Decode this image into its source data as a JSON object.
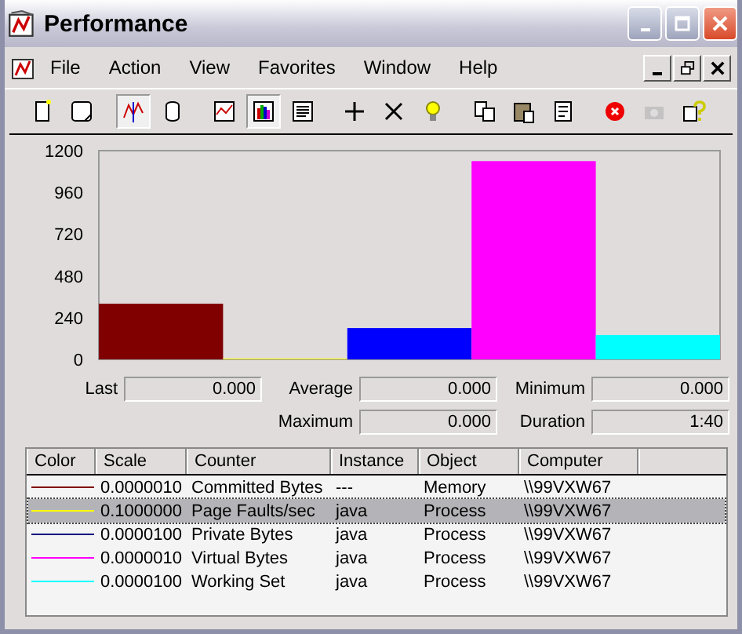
{
  "window": {
    "title": "Performance"
  },
  "menu": [
    {
      "label": "File"
    },
    {
      "label": "Action"
    },
    {
      "label": "View"
    },
    {
      "label": "Favorites"
    },
    {
      "label": "Window"
    },
    {
      "label": "Help"
    }
  ],
  "toolbar": [
    {
      "kind": "new",
      "selected": false,
      "disabled": false
    },
    {
      "kind": "clear",
      "selected": false,
      "disabled": false
    },
    {
      "kind": "current",
      "selected": true,
      "disabled": false
    },
    {
      "kind": "log",
      "selected": false,
      "disabled": false
    },
    {
      "kind": "graph",
      "selected": false,
      "disabled": false
    },
    {
      "kind": "histogram",
      "selected": true,
      "disabled": false
    },
    {
      "kind": "report",
      "selected": false,
      "disabled": false
    },
    {
      "kind": "add",
      "selected": false,
      "disabled": false
    },
    {
      "kind": "delete",
      "selected": false,
      "disabled": false
    },
    {
      "kind": "highlight",
      "selected": false,
      "disabled": false
    },
    {
      "kind": "copy",
      "selected": false,
      "disabled": false
    },
    {
      "kind": "paste",
      "selected": false,
      "disabled": false
    },
    {
      "kind": "properties",
      "selected": false,
      "disabled": false
    },
    {
      "kind": "freeze",
      "selected": false,
      "disabled": false
    },
    {
      "kind": "update",
      "selected": false,
      "disabled": true
    },
    {
      "kind": "help",
      "selected": false,
      "disabled": false
    }
  ],
  "chart": {
    "chart_data": {
      "type": "bar",
      "ylim": [
        0,
        1200
      ],
      "yticks": [
        0,
        240,
        480,
        720,
        960,
        1200
      ],
      "series": [
        {
          "color": "#800000",
          "values": [
            320
          ]
        },
        {
          "color": "#ffff00",
          "values": [
            0
          ]
        },
        {
          "color": "#0000ff",
          "values": [
            180
          ]
        },
        {
          "color": "#ff00ff",
          "values": [
            1140
          ]
        },
        {
          "color": "#00ffff",
          "values": [
            140
          ]
        }
      ]
    }
  },
  "stats": {
    "last": {
      "label": "Last",
      "value": "0.000"
    },
    "average": {
      "label": "Average",
      "value": "0.000"
    },
    "minimum": {
      "label": "Minimum",
      "value": "0.000"
    },
    "maximum": {
      "label": "Maximum",
      "value": "0.000"
    },
    "duration": {
      "label": "Duration",
      "value": "1:40"
    }
  },
  "table": {
    "columns": [
      "Color",
      "Scale",
      "Counter",
      "Instance",
      "Object",
      "Computer"
    ],
    "rows": [
      {
        "color": "#800000",
        "scale": "0.0000010",
        "counter": "Committed Bytes",
        "instance": "---",
        "object": "Memory",
        "computer": "\\\\99VXW67",
        "selected": false
      },
      {
        "color": "#ffff00",
        "scale": "0.1000000",
        "counter": "Page Faults/sec",
        "instance": "java",
        "object": "Process",
        "computer": "\\\\99VXW67",
        "selected": true
      },
      {
        "color": "#000080",
        "scale": "0.0000100",
        "counter": "Private Bytes",
        "instance": "java",
        "object": "Process",
        "computer": "\\\\99VXW67",
        "selected": false
      },
      {
        "color": "#ff00ff",
        "scale": "0.0000010",
        "counter": "Virtual Bytes",
        "instance": "java",
        "object": "Process",
        "computer": "\\\\99VXW67",
        "selected": false
      },
      {
        "color": "#00ffff",
        "scale": "0.0000100",
        "counter": "Working Set",
        "instance": "java",
        "object": "Process",
        "computer": "\\\\99VXW67",
        "selected": false
      }
    ]
  }
}
